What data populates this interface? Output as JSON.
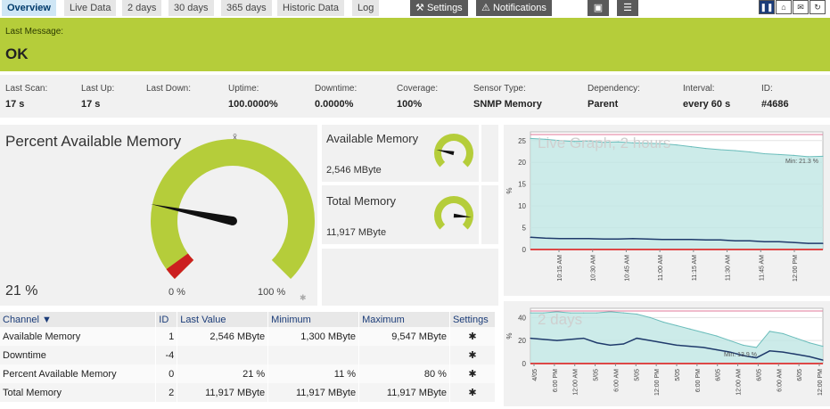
{
  "tabs": [
    {
      "label": "Overview",
      "active": true
    },
    {
      "label": "Live Data"
    },
    {
      "label": "2 days"
    },
    {
      "label": "30 days"
    },
    {
      "label": "365 days"
    },
    {
      "label": "Historic Data"
    },
    {
      "label": "Log"
    }
  ],
  "toolbar": {
    "settings_label": "Settings",
    "notifications_label": "Notifications"
  },
  "banner": {
    "label": "Last Message:",
    "value": "OK",
    "color": "#b5cd3a"
  },
  "stats": [
    {
      "key": "Last Scan:",
      "value": "17 s"
    },
    {
      "key": "Last Up:",
      "value": "17 s"
    },
    {
      "key": "Last Down:",
      "value": ""
    },
    {
      "key": "Uptime:",
      "value": "100.0000%"
    },
    {
      "key": "Downtime:",
      "value": "0.0000%"
    },
    {
      "key": "Coverage:",
      "value": "100%"
    },
    {
      "key": "Sensor Type:",
      "value": "SNMP Memory"
    },
    {
      "key": "Dependency:",
      "value": "Parent"
    },
    {
      "key": "Interval:",
      "value": "every 60 s"
    },
    {
      "key": "ID:",
      "value": "#4686"
    }
  ],
  "main_gauge": {
    "title": "Percent Available Memory",
    "value": "21 %",
    "min_label": "0 %",
    "max_label": "100 %",
    "mean_symbol": "x̄",
    "fraction": 0.21
  },
  "small_gauges": [
    {
      "title": "Available Memory",
      "value": "2,546 MByte",
      "fraction": 0.21
    },
    {
      "title": "Total Memory",
      "value": "11,917 MByte",
      "fraction": 0.85
    }
  ],
  "table": {
    "headers": [
      "Channel",
      "ID",
      "Last Value",
      "Minimum",
      "Maximum",
      "Settings"
    ],
    "rows": [
      {
        "channel": "Available Memory",
        "id": "1",
        "last": "2,546 MByte",
        "min": "1,300 MByte",
        "max": "9,547 MByte"
      },
      {
        "channel": "Downtime",
        "id": "-4",
        "last": "",
        "min": "",
        "max": ""
      },
      {
        "channel": "Percent Available Memory",
        "id": "0",
        "last": "21 %",
        "min": "11 %",
        "max": "80 %"
      },
      {
        "channel": "Total Memory",
        "id": "2",
        "last": "11,917 MByte",
        "min": "11,917 MByte",
        "max": "11,917 MByte"
      }
    ]
  },
  "chart_data": [
    {
      "type": "area",
      "title": "Live Graph, 2 hours",
      "ylabel": "%",
      "ylim": [
        0,
        27
      ],
      "yticks": [
        0,
        5,
        10,
        15,
        20,
        25
      ],
      "xticks": [
        "10:15 AM",
        "10:30 AM",
        "10:45 AM",
        "11:00 AM",
        "11:15 AM",
        "11:30 AM",
        "11:45 AM",
        "12:00 PM"
      ],
      "annotation": "Min: 21.3 %",
      "series": [
        {
          "values": [
            25.5,
            25.3,
            25.0,
            24.8,
            24.9,
            24.6,
            24.7,
            24.5,
            24.4,
            24.3,
            24.0,
            23.6,
            23.2,
            22.9,
            22.7,
            22.4,
            22.0,
            21.8,
            21.6,
            21.3,
            21.4
          ]
        },
        {
          "values": [
            2.8,
            2.6,
            2.5,
            2.5,
            2.5,
            2.4,
            2.4,
            2.5,
            2.4,
            2.3,
            2.3,
            2.3,
            2.2,
            2.2,
            2.0,
            2.0,
            1.8,
            1.8,
            1.6,
            1.4,
            1.4
          ]
        }
      ]
    },
    {
      "type": "area",
      "title": "2 days",
      "ylabel": "%",
      "ylim": [
        0,
        48
      ],
      "yticks": [
        0,
        20,
        40
      ],
      "xticks": [
        "4/05",
        "6:00 PM",
        "12:00 AM",
        "5/05",
        "6:00 AM",
        "5/05",
        "12:00 PM",
        "5/05",
        "6:00 PM",
        "6/05",
        "12:00 AM",
        "6/05",
        "6:00 AM",
        "6/05",
        "12:00 PM"
      ],
      "annotation": "Min: 13.9 %",
      "series": [
        {
          "values": [
            44,
            44,
            45,
            44,
            44,
            44,
            45,
            44,
            43,
            40,
            36,
            33,
            30,
            27,
            24,
            20,
            16,
            14,
            28,
            26,
            22,
            18,
            15
          ]
        },
        {
          "values": [
            22,
            21,
            20,
            21,
            22,
            18,
            16,
            17,
            22,
            20,
            18,
            16,
            15,
            14,
            12,
            10,
            7,
            5,
            11,
            10,
            8,
            6,
            3
          ]
        }
      ]
    }
  ]
}
